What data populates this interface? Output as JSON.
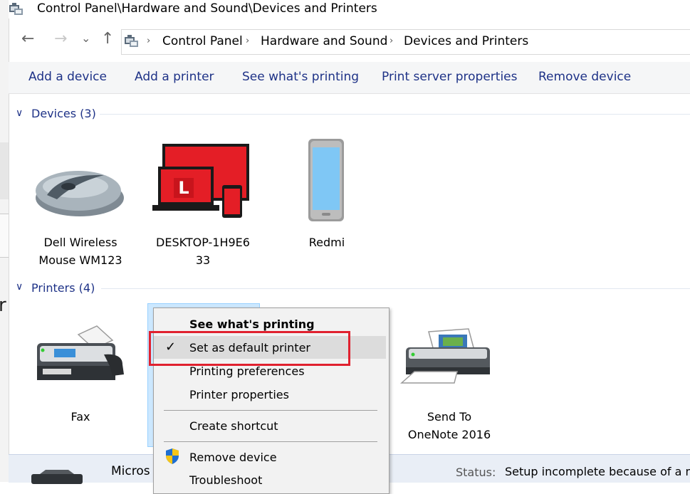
{
  "window": {
    "title": "Control Panel\\Hardware and Sound\\Devices and Printers"
  },
  "nav": {
    "back_glyph": "←",
    "forward_glyph": "→",
    "recent_glyph": "⌄",
    "up_glyph": "↑"
  },
  "breadcrumb": [
    "Control Panel",
    "Hardware and Sound",
    "Devices and Printers"
  ],
  "breadcrumb_sep": "›",
  "commands": [
    "Add a device",
    "Add a printer",
    "See what's printing",
    "Print server properties",
    "Remove device"
  ],
  "devices_group": {
    "label": "Devices (3)",
    "chevron": "∨",
    "items": [
      {
        "label_line1": "Dell Wireless",
        "label_line2": "Mouse WM123"
      },
      {
        "label_line1": "DESKTOP-1H9E6",
        "label_line2": "33",
        "badge_letter": "L"
      },
      {
        "label_line1": "Redmi",
        "label_line2": ""
      }
    ]
  },
  "printers_group": {
    "label": "Printers (4)",
    "chevron": "∨",
    "items": [
      {
        "label_line1": "Fax",
        "label_line2": ""
      },
      {
        "label_line1": "Send To",
        "label_line2": "OneNote 2016"
      }
    ]
  },
  "context_menu": {
    "items": [
      {
        "label": "See what's printing",
        "bold": true
      },
      {
        "label": "Set as default printer",
        "checked": true
      },
      {
        "label": "Printing preferences"
      },
      {
        "label": "Printer properties"
      },
      {
        "label": "Create shortcut"
      },
      {
        "label": "Remove device",
        "icon": "shield-icon"
      },
      {
        "label": "Troubleshoot"
      }
    ],
    "check_glyph": "✓"
  },
  "details_pane": {
    "name_partial": "Micros",
    "status_label": "Status:",
    "status_value": "Setup incomplete because of a m"
  },
  "behind_window": {
    "letter": "r"
  },
  "colors": {
    "link_blue": "#1e3287",
    "highlight_red": "#e0212f",
    "selection_blue": "#cce8ff",
    "device_red": "#e41e26"
  }
}
